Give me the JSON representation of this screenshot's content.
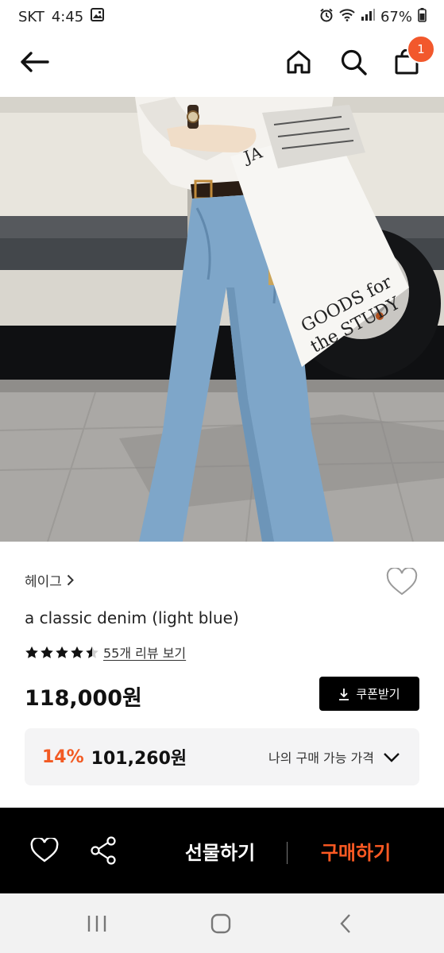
{
  "status_bar": {
    "carrier": "SKT",
    "time": "4:45",
    "battery": "67%",
    "icons": [
      "gallery-icon",
      "alarm-icon",
      "wifi-icon",
      "signal-icon",
      "battery-icon"
    ]
  },
  "header": {
    "icons": [
      "back-arrow-icon",
      "home-icon",
      "search-icon",
      "shopping-bag-icon"
    ],
    "cart_count": "1"
  },
  "hero": {
    "bag_text_line1": "GOODS for",
    "bag_text_line2": "the STUDY"
  },
  "product": {
    "brand": "헤이그",
    "name": "a classic denim (light blue)",
    "rating": 4.5,
    "review_link": "55개 리뷰 보기",
    "price": "118,000원",
    "coupon_label": "쿠폰받기"
  },
  "discount": {
    "percent": "14%",
    "price": "101,260원",
    "my_price_label": "나의 구매 가능 가격"
  },
  "action_bar": {
    "gift_label": "선물하기",
    "buy_label": "구매하기",
    "icons": [
      "heart-icon",
      "share-icon"
    ]
  },
  "colors": {
    "accent": "#f25a23",
    "badge": "#f2582c",
    "action_bar_bg": "#000000",
    "discount_bg": "#f4f4f5"
  }
}
